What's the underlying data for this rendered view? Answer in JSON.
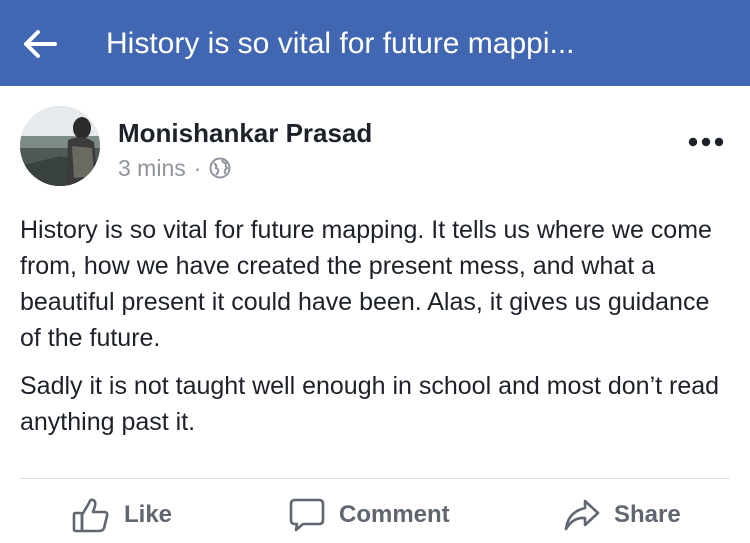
{
  "header": {
    "back_icon": "back-arrow-icon",
    "title": "History is so vital for future mappi..."
  },
  "post": {
    "author": "Monishankar Prasad",
    "time": "3 mins",
    "separator": "·",
    "audience_icon": "globe-icon",
    "more_icon": "more-options-icon",
    "paragraphs": [
      "History is so vital for future mapping. It tells us where we come from, how we have created the present mess, and what a beautiful present it could have been. Alas, it gives us guidance of the future.",
      "Sadly it is not taught well enough in school and most don’t read anything past it."
    ]
  },
  "actions": {
    "like": "Like",
    "comment": "Comment",
    "share": "Share"
  },
  "colors": {
    "header_bg": "#4267b2",
    "text_primary": "#1d2129",
    "text_secondary": "#90949c",
    "action_text": "#606770"
  }
}
